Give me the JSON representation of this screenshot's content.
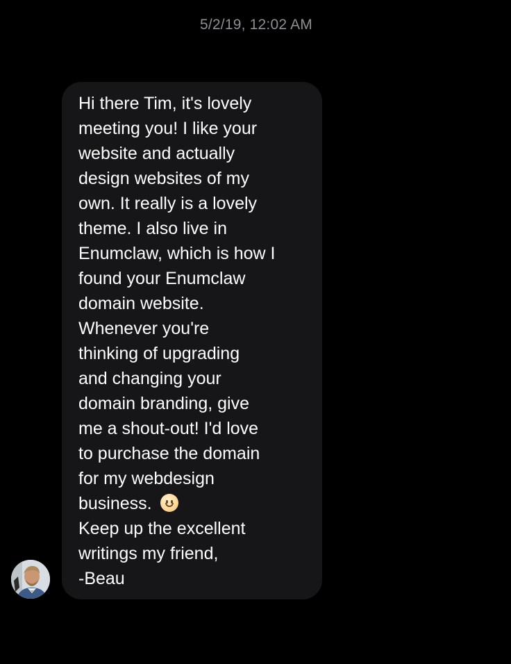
{
  "conversation": {
    "timestamp": "5/2/19, 12:02 AM",
    "message": {
      "lines": [
        "Hi there Tim, it's lovely",
        "meeting you! I like your",
        "website and actually",
        "design websites of my",
        "own. It really is a lovely",
        "theme. I also live in",
        "Enumclaw, which is how I",
        "found your Enumclaw",
        "domain website.",
        "Whenever you're",
        "thinking of upgrading",
        "and changing your",
        "domain branding, give",
        "me a shout-out! I'd love",
        "to purchase the domain",
        "for my webdesign",
        "business.",
        "Keep up the excellent",
        "writings my friend,",
        "-Beau"
      ],
      "emoji": "slightly-smiling-face-icon"
    },
    "sender": {
      "avatar": "user-avatar"
    }
  },
  "colors": {
    "background": "#000000",
    "bubble": "#161518",
    "text": "#ffffff",
    "timestamp": "#8e8e93"
  }
}
